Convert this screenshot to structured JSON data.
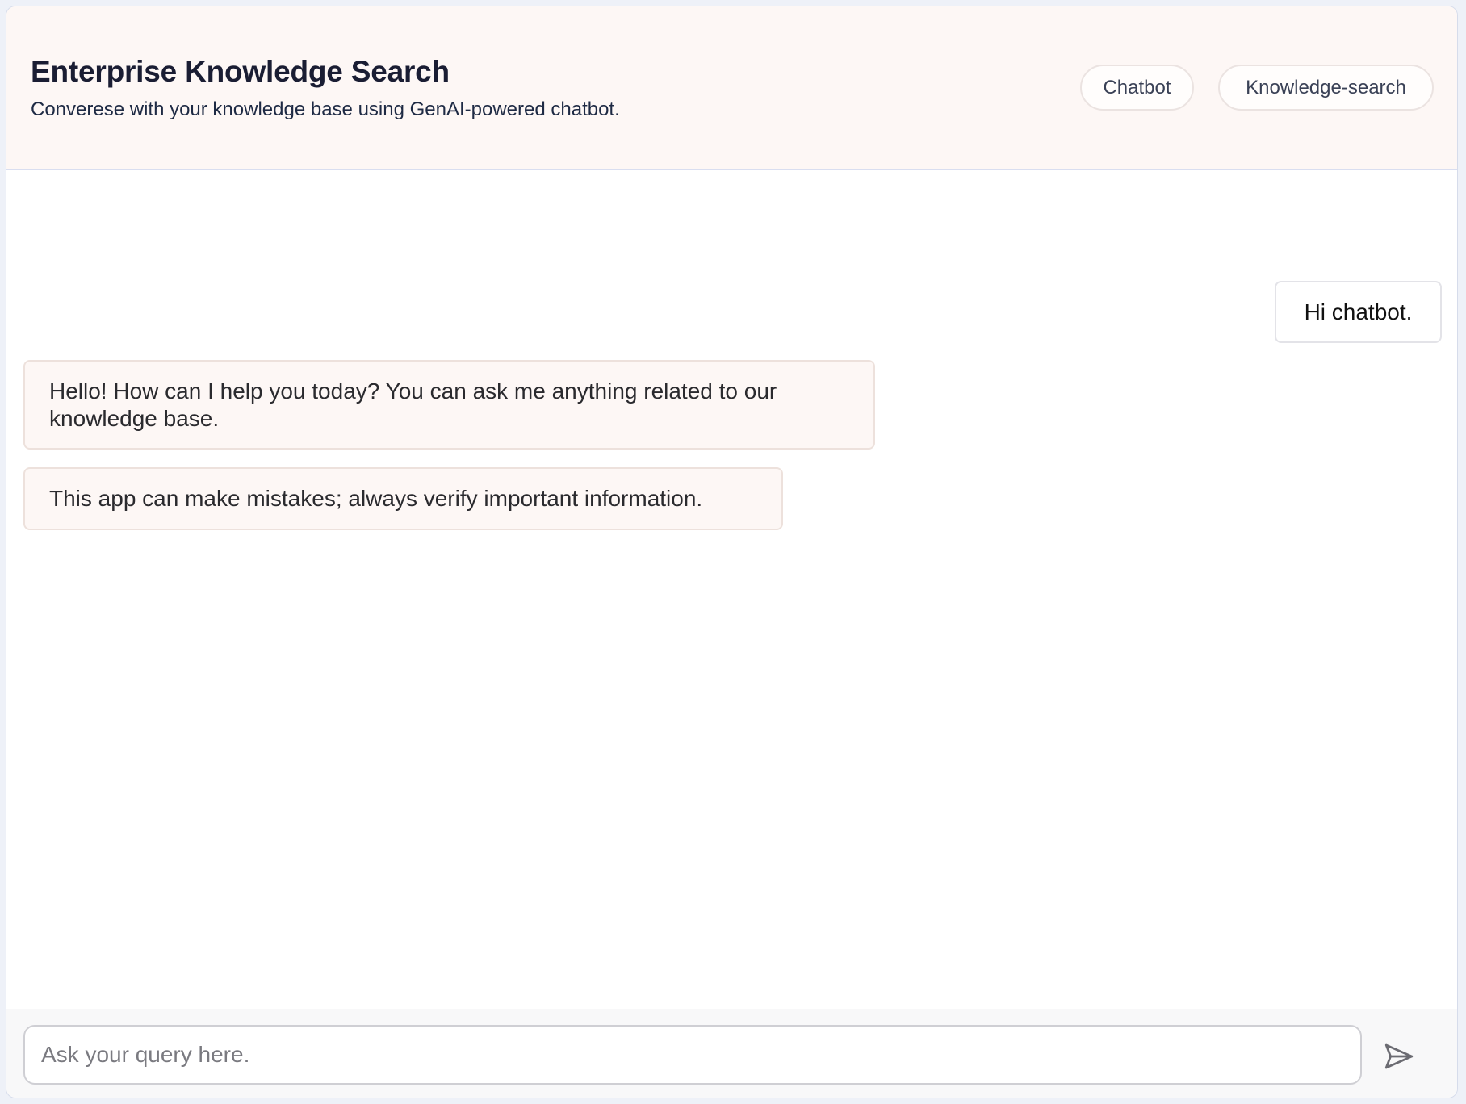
{
  "header": {
    "title": "Enterprise Knowledge Search",
    "subtitle": "Converese with your knowledge base using GenAI-powered chatbot.",
    "tabs": [
      {
        "label": "Chatbot"
      },
      {
        "label": "Knowledge-search"
      }
    ]
  },
  "chat": {
    "messages": [
      {
        "role": "user",
        "text": "Hi chatbot."
      },
      {
        "role": "assistant",
        "text": "Hello! How can I help you today? You can ask me anything related to our knowledge base."
      },
      {
        "role": "assistant",
        "text": "This app can make mistakes; always verify important information."
      }
    ]
  },
  "composer": {
    "placeholder": "Ask your query here.",
    "value": "",
    "send_icon": "send-icon"
  },
  "colors": {
    "header_bg": "#fdf7f5",
    "bot_bubble_bg": "#fdf7f5",
    "title_text": "#1a1d33"
  }
}
